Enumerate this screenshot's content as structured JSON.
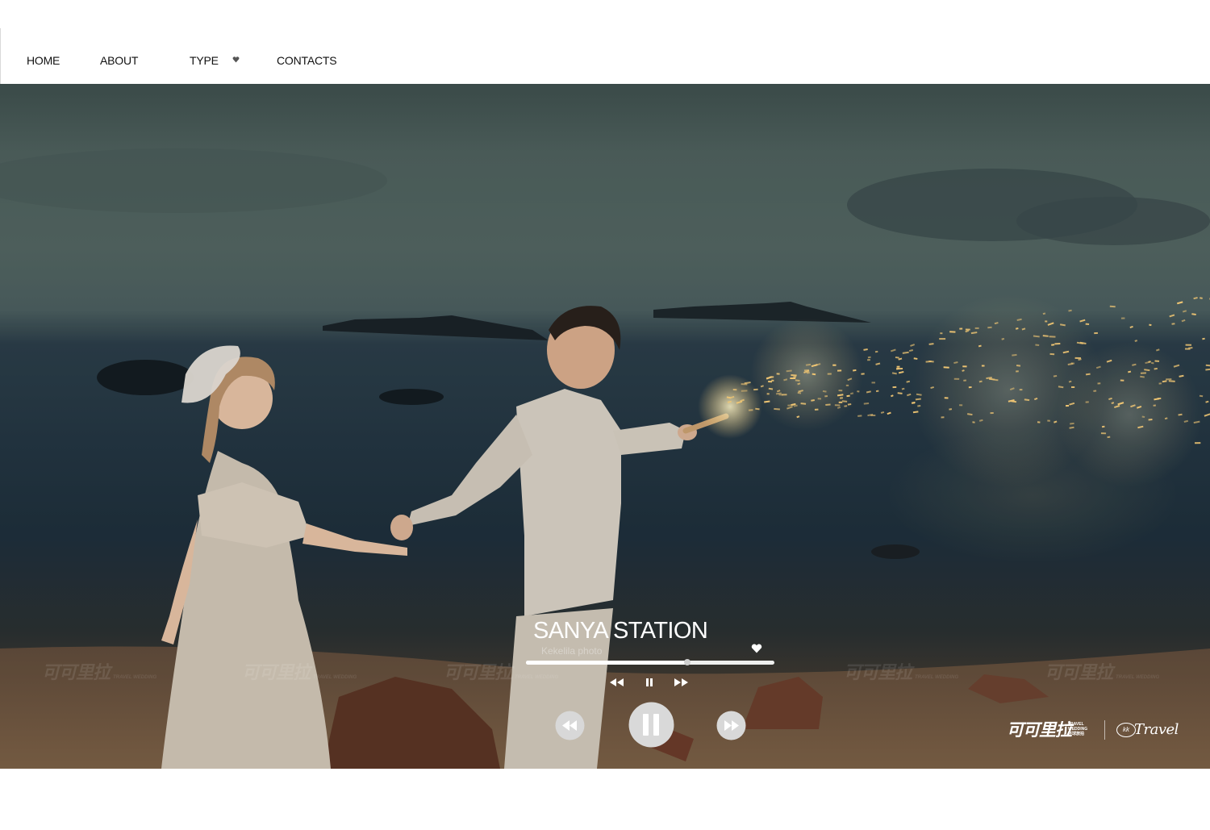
{
  "nav": {
    "items": [
      {
        "label": "HOME"
      },
      {
        "label": "ABOUT"
      },
      {
        "label": "TYPE"
      },
      {
        "label": "CONTACTS"
      }
    ],
    "type_dropdown_icon": "chevron-down-icon"
  },
  "player": {
    "title": "SANYA STATION",
    "artist": "Kekelila photo",
    "progress": 0.65,
    "icons": {
      "like": "heart-icon",
      "small_prev": "rewind-icon",
      "small_pause": "pause-icon",
      "small_next": "fast-forward-icon",
      "big_prev": "rewind-icon",
      "big_pause": "pause-icon",
      "big_next": "fast-forward-icon"
    }
  },
  "branding": {
    "logo_cn": "可可里拉",
    "logo_sub": "TRAVEL WEDDING 环球旅拍",
    "badge": "kk",
    "travel": "Travel"
  },
  "watermark": {
    "text": "可可里拉",
    "sub": "TRAVEL WEDDING"
  },
  "colors": {
    "nav_text": "#111111",
    "overlay_text": "#ffffff",
    "sparkle": "#ffd27a"
  }
}
